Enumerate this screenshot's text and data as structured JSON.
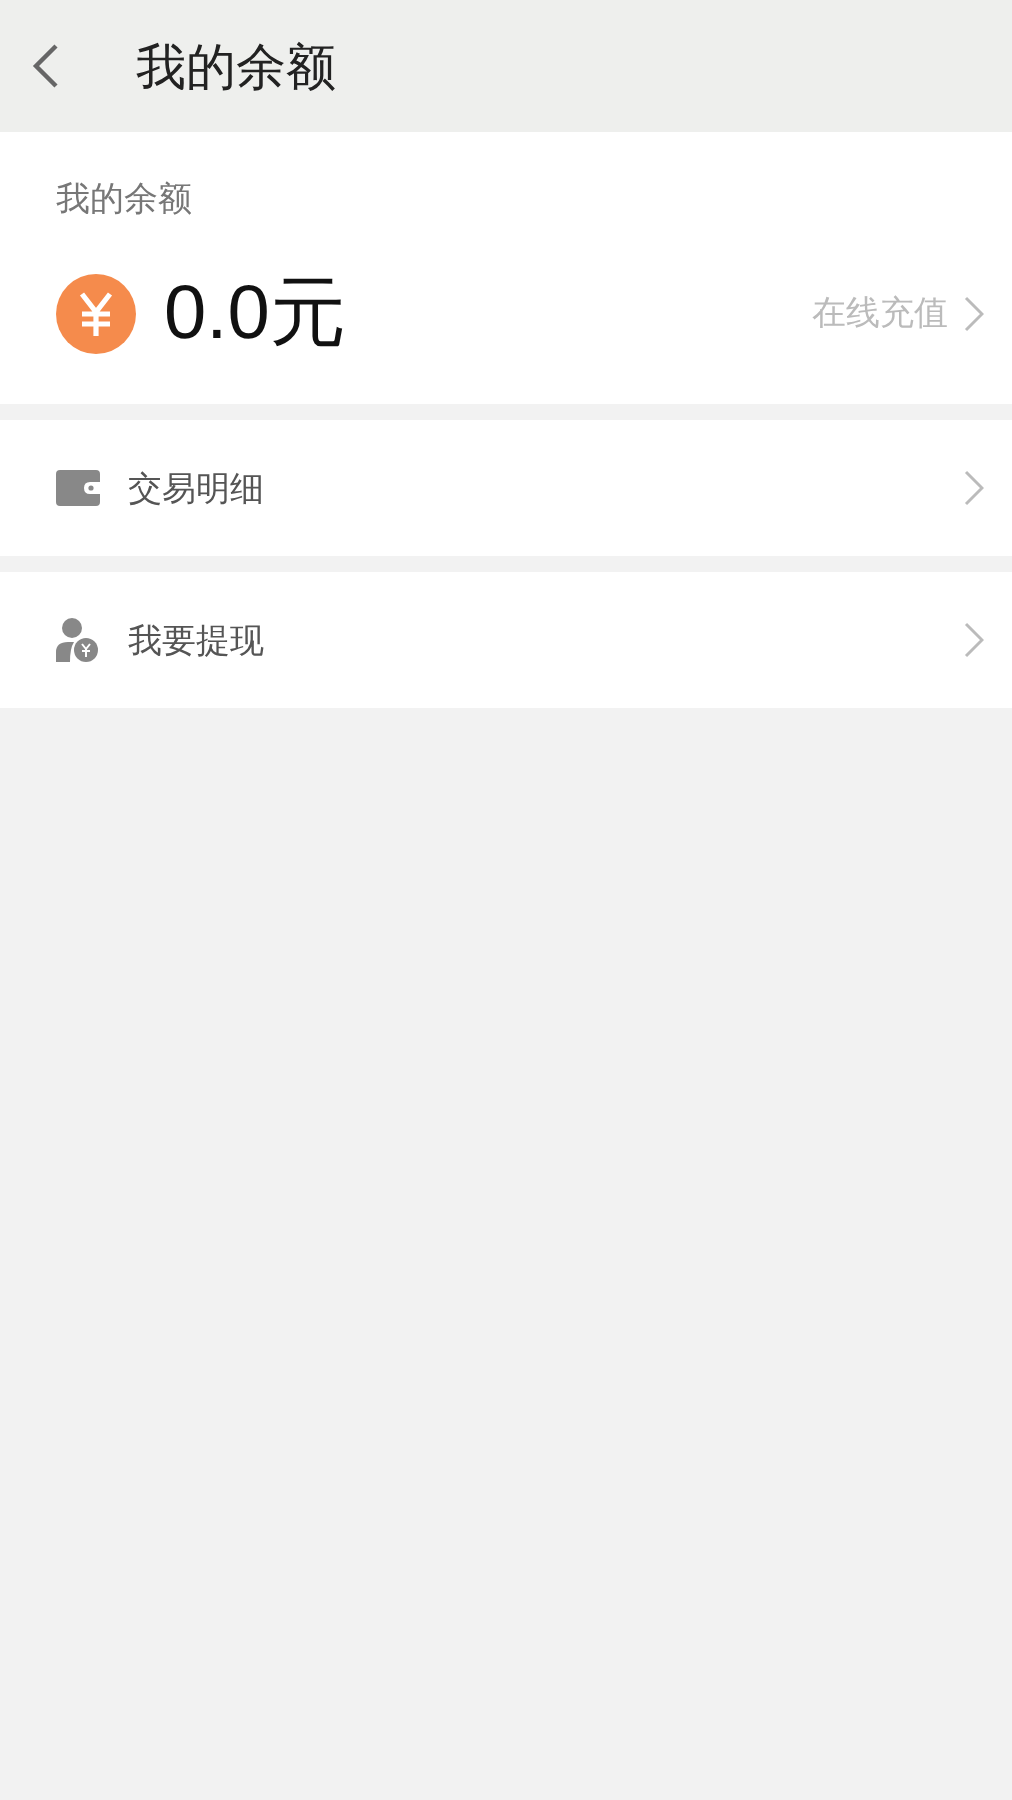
{
  "header": {
    "title": "我的余额"
  },
  "balance": {
    "label": "我的余额",
    "amount": "0.0元",
    "recharge": "在线充值"
  },
  "menu": [
    {
      "kind": "wallet",
      "label": "交易明细"
    },
    {
      "kind": "withdraw",
      "label": "我要提现"
    }
  ]
}
